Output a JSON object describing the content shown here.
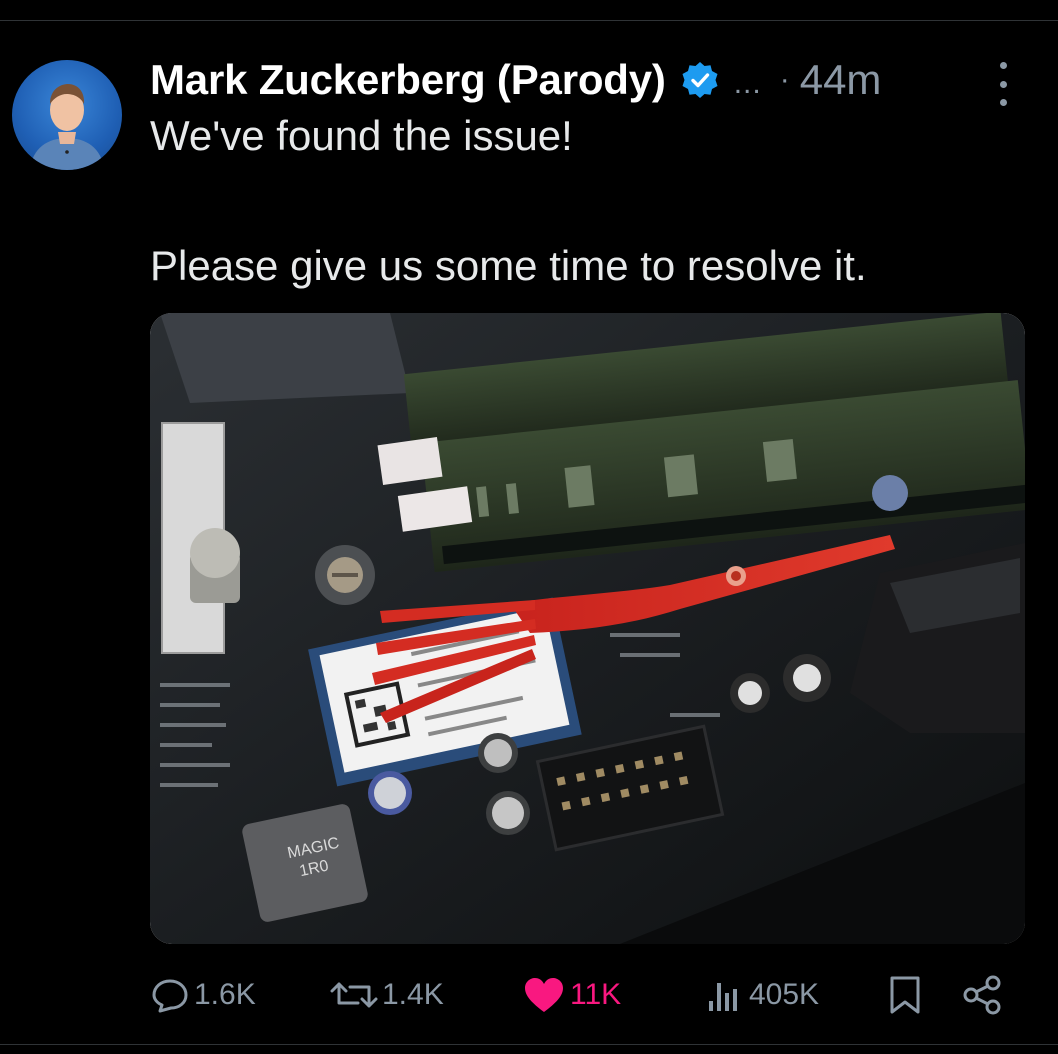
{
  "post": {
    "author": "Mark Zuckerberg (Parody)",
    "verified_icon": "verified-badge-icon",
    "handle_truncated": "...",
    "separator": "·",
    "timestamp": "44m",
    "text_line1": "We've found the issue!",
    "text_line2": "Please give us some time to resolve it.",
    "media": {
      "description_icon": "motherboard-photo",
      "chip_label": "MAGIC\n1R0"
    }
  },
  "actions": {
    "replies": "1.6K",
    "reposts": "1.4K",
    "likes": "11K",
    "views": "405K"
  },
  "colors": {
    "background": "#000000",
    "text": "#e7e9ea",
    "muted": "#8b98a5",
    "like": "#f91880",
    "verified": "#1d9bf0"
  }
}
